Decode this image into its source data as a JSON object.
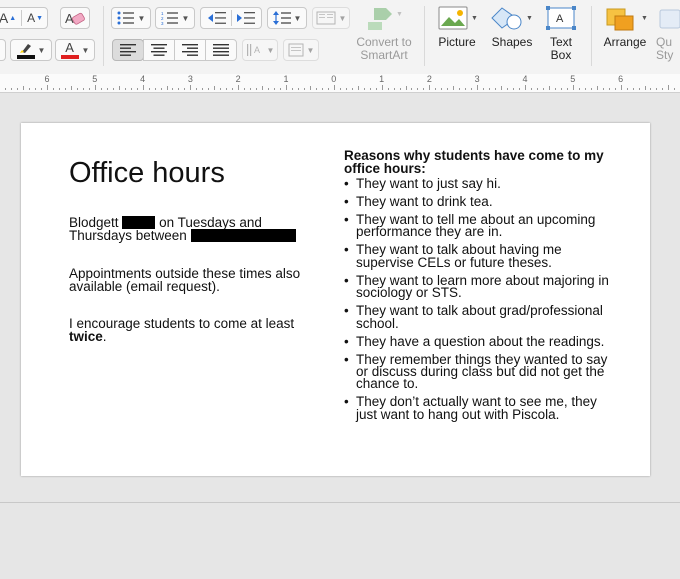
{
  "toolbar": {
    "grow_font": "A",
    "shrink_font": "A",
    "convert_smartart": "Convert to SmartArt",
    "picture": "Picture",
    "shapes": "Shapes",
    "text_box": "Text Box",
    "arrange": "Arrange",
    "quick_styles": "Qu Sty",
    "colors": {
      "highlight": "#ffd400",
      "font_color": "#e02020",
      "brand_orange": "#f0a020"
    },
    "icons": [
      "clear-format-icon",
      "bullets-icon",
      "numbering-icon",
      "decrease-indent-icon",
      "increase-indent-icon",
      "line-spacing-icon",
      "columns-icon",
      "smartart-icon",
      "highlight-icon",
      "font-color-icon",
      "align-left-icon",
      "align-center-icon",
      "align-right-icon",
      "justify-icon",
      "text-direction-icon",
      "align-text-icon",
      "picture-icon",
      "shapes-icon",
      "textbox-icon",
      "arrange-icon",
      "quick-styles-icon"
    ]
  },
  "ruler": {
    "labels": [
      "6",
      "5",
      "4",
      "3",
      "2",
      "1",
      "0",
      "1",
      "2",
      "3",
      "4",
      "5",
      "6"
    ]
  },
  "slide": {
    "title": "Office hours",
    "schedule": {
      "line1_a": "Blodgett",
      "line1_b": "on Tuesdays and",
      "line2": "Thursdays between"
    },
    "appointments": "Appointments outside these times also available (email request).",
    "encourage_a": "I encourage students to come at least",
    "encourage_bold": "twice",
    "encourage_end": ".",
    "reasons_heading": "Reasons why students have come to my office hours:",
    "reasons": [
      "They want to just say hi.",
      "They want to drink tea.",
      "They want to tell me about an upcoming performance they are in.",
      "They want to talk about having me supervise CELs or future theses.",
      "They want to learn more about majoring in sociology or STS.",
      "They want to talk about grad/professional school.",
      "They have a question about the readings.",
      "They remember things they wanted to say or discuss during class but did not get the chance to.",
      "They don’t actually want to see me, they just want to hang out with Piscola."
    ]
  }
}
